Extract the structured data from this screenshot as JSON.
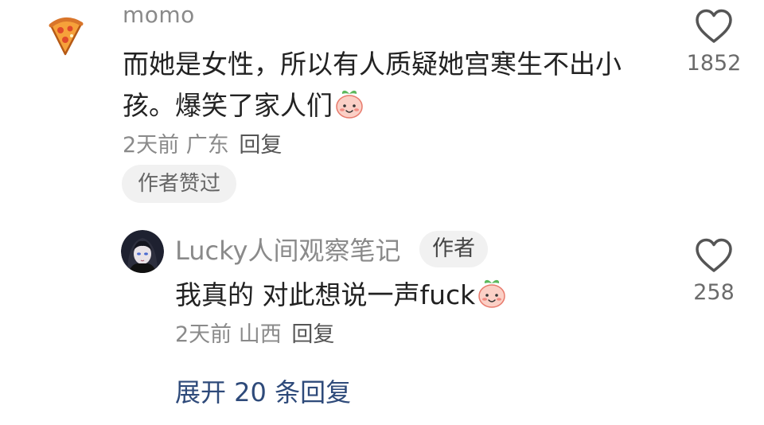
{
  "comment": {
    "username": "momo",
    "text": "而她是女性，所以有人质疑她宫寒生不出小孩。爆笑了家人们",
    "emoji": "smiling-peach-emoji",
    "time": "2天前",
    "location": "广东",
    "reply_label": "回复",
    "liked_by_author": "作者赞过",
    "like_count": "1852",
    "avatar": "pizza-avatar"
  },
  "reply": {
    "username": "Lucky人间观察笔记",
    "author_tag": "作者",
    "text": "我真的 对此想说一声fuck",
    "emoji": "smiling-peach-emoji",
    "time": "2天前",
    "location": "山西",
    "reply_label": "回复",
    "like_count": "258",
    "avatar": "anime-girl-avatar"
  },
  "expand_replies": "展开 20 条回复",
  "colors": {
    "meta_gray": "#8a8a8a",
    "link_blue": "#2e4a7a",
    "chip_bg": "#f1f1f1"
  }
}
